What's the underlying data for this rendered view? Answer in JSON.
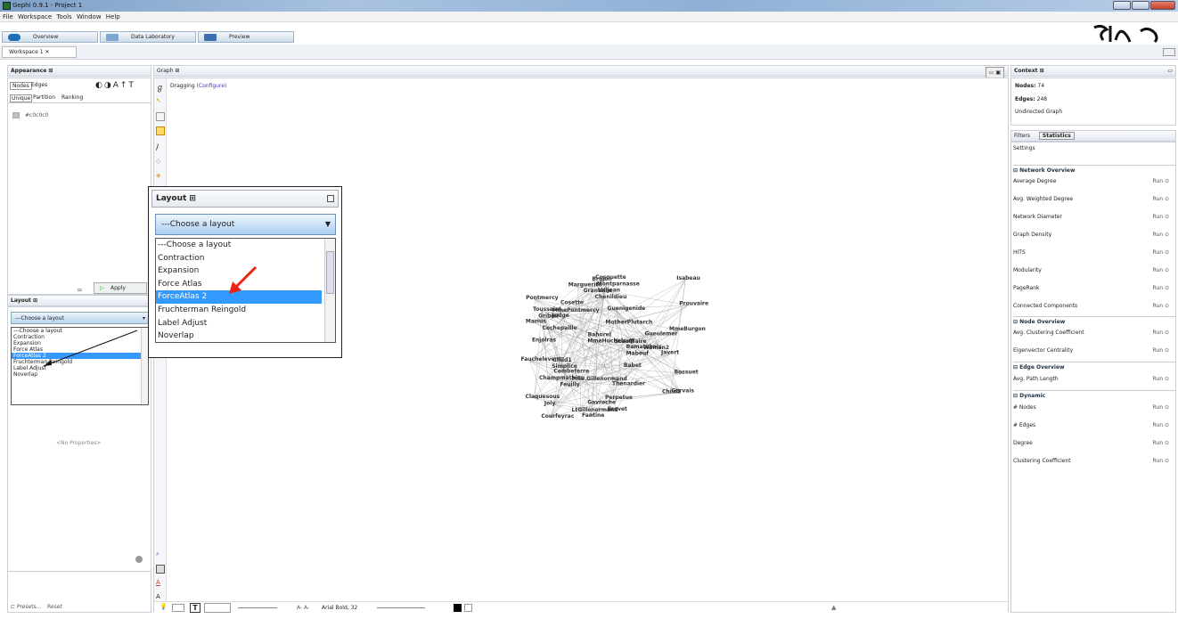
{
  "window": {
    "title": "Gephi 0.9.1 - Project 1"
  },
  "menu": [
    "File",
    "Workspace",
    "Tools",
    "Window",
    "Help"
  ],
  "perspectives": {
    "overview": "Overview",
    "datalab": "Data Laboratory",
    "preview": "Preview"
  },
  "workspace_tab": "Workspace 1",
  "appearance": {
    "title": "Appearance",
    "tabs": [
      "Nodes",
      "Edges"
    ],
    "subtabs": [
      "Unique",
      "Partition",
      "Ranking"
    ],
    "color_value": "#c0c0c0",
    "apply": "Apply"
  },
  "layout_small": {
    "title": "Layout",
    "select": "---Choose a layout",
    "options": [
      "---Choose a layout",
      "Contraction",
      "Expansion",
      "Force Atlas",
      "ForceAtlas 2",
      "Fruchterman Reingold",
      "Label Adjust",
      "Noverlap"
    ],
    "selected": "ForceAtlas 2",
    "no_props": "<No Properties>",
    "presets": "Presets...",
    "reset": "Reset"
  },
  "layout_zoom": {
    "title": "Layout",
    "select": "---Choose a layout",
    "options": [
      "---Choose a layout",
      "Contraction",
      "Expansion",
      "Force Atlas",
      "ForceAtlas 2",
      "Fruchterman Reingold",
      "Label Adjust",
      "Noverlap"
    ],
    "selected": "ForceAtlas 2"
  },
  "graph": {
    "title": "Graph",
    "mode": "Dragging",
    "configure": "(Configure)",
    "font": "Arial Bold, 32"
  },
  "context": {
    "title": "Context",
    "nodes_label": "Nodes:",
    "nodes": "74",
    "edges_label": "Edges:",
    "edges": "248",
    "type": "Undirected Graph"
  },
  "statistics": {
    "tabs": [
      "Filters",
      "Statistics"
    ],
    "settings": "Settings",
    "sections": [
      {
        "name": "Network Overview",
        "items": [
          "Average Degree",
          "Avg. Weighted Degree",
          "Network Diameter",
          "Graph Density",
          "HITS",
          "Modularity",
          "PageRank",
          "Connected Components"
        ]
      },
      {
        "name": "Node Overview",
        "items": [
          "Avg. Clustering Coefficient",
          "Eigenvector Centrality"
        ]
      },
      {
        "name": "Edge Overview",
        "items": [
          "Avg. Path Length"
        ]
      },
      {
        "name": "Dynamic",
        "items": [
          "# Nodes",
          "# Edges",
          "Degree",
          "Clustering Coefficient"
        ]
      }
    ],
    "run": "Run"
  },
  "nodes": [
    "Cosquette",
    "Guenigenide",
    "Enjolras",
    "Combeferre",
    "Gavroche",
    "Valjean",
    "Marius",
    "Javert",
    "Thenardier",
    "Fantine",
    "Cosette",
    "Gueulemer",
    "Babet",
    "Claquesous",
    "Montparnasse",
    "Judge",
    "Bamatabois",
    "Champmathieu",
    "Brevet",
    "Chenildieu",
    "Cochepaille",
    "Fauchelevent",
    "Gervais",
    "Isabeau",
    "Toussaint",
    "MmeHucheloup",
    "Bossuet",
    "Joly",
    "Grantaire",
    "MotherPlutarch",
    "Mabeuf",
    "Feuilly",
    "Courfeyrac",
    "Prouvaire",
    "Bahorel",
    "Simplice",
    "Perpetue",
    "Marguerite",
    "Gribier",
    "Woman2",
    "Mlle.Gillenormand",
    "LtGillenormand",
    "Pontmercy",
    "MmeBurgon",
    "Child1",
    "Child2",
    "Brujon",
    "MmePontmercy",
    "Scaufflaire"
  ]
}
